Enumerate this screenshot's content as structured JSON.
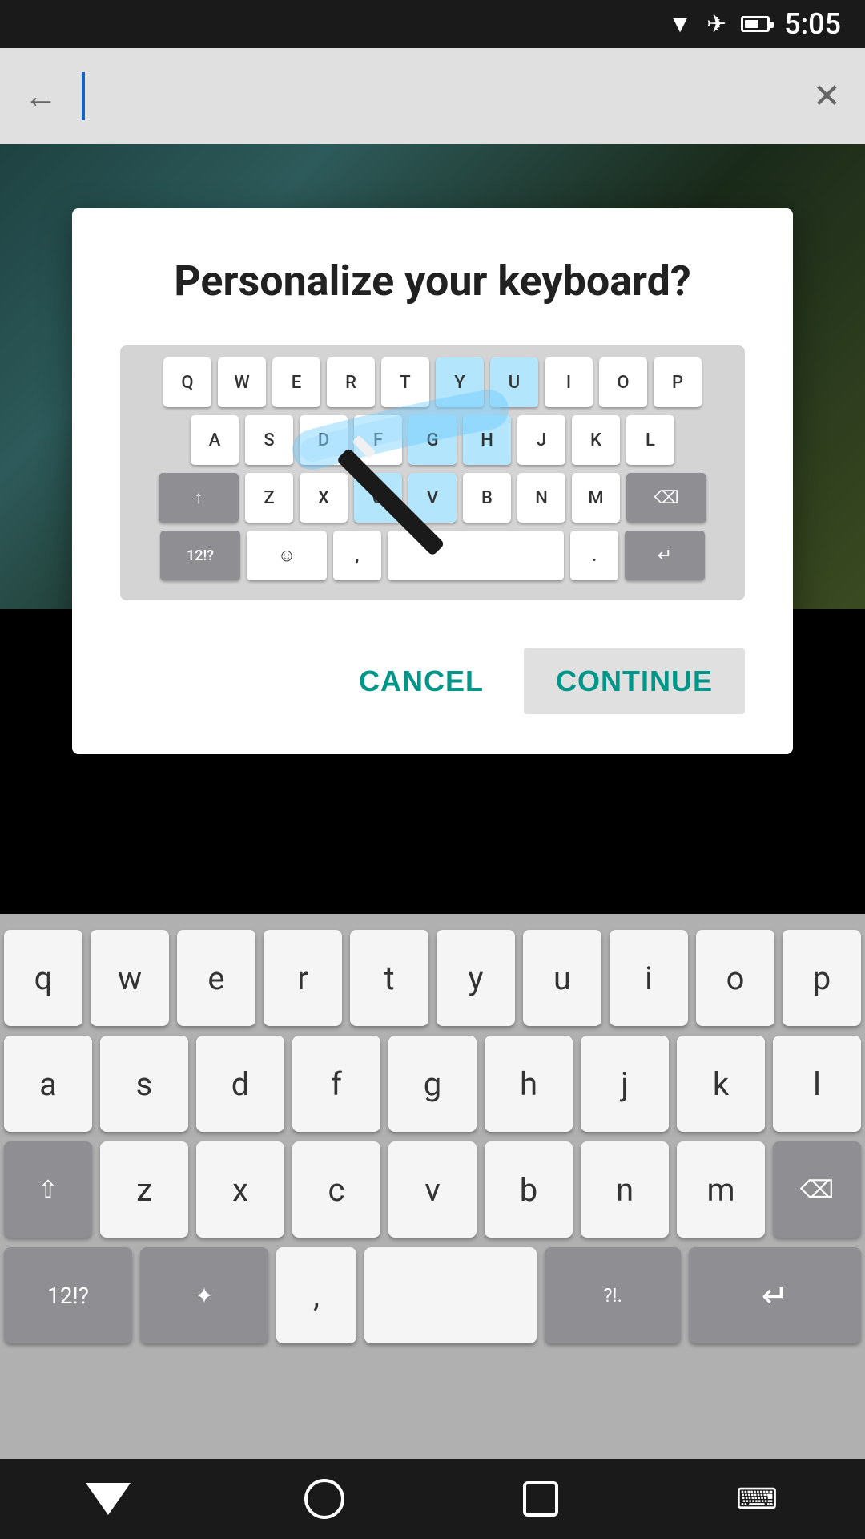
{
  "statusBar": {
    "time": "5:05"
  },
  "searchBar": {
    "backLabel": "←",
    "clearLabel": "✕"
  },
  "dialog": {
    "title": "Personalize your keyboard?",
    "miniKeyboard": {
      "rows": [
        [
          "Q",
          "W",
          "E",
          "R",
          "T",
          "Y",
          "U",
          "I",
          "O",
          "P"
        ],
        [
          "A",
          "S",
          "D",
          "F",
          "G",
          "H",
          "J",
          "K",
          "L"
        ],
        [
          "↑",
          "Z",
          "X",
          "C",
          "V",
          "B",
          "N",
          "M",
          "⌫"
        ],
        [
          "12!?",
          "☺",
          ",",
          " ",
          ".",
          "↵"
        ]
      ]
    },
    "cancelLabel": "CANCEL",
    "continueLabel": "CONTINUE"
  },
  "keyboard": {
    "rows": [
      [
        "q",
        "w",
        "e",
        "r",
        "t",
        "y",
        "u",
        "i",
        "o",
        "p"
      ],
      [
        "a",
        "s",
        "d",
        "f",
        "g",
        "h",
        "j",
        "k",
        "l"
      ],
      [
        "⇧",
        "z",
        "x",
        "c",
        "v",
        "b",
        "n",
        "m",
        "⌫"
      ],
      [
        "12!?",
        "✦",
        ",",
        "",
        "?!.",
        "↵"
      ]
    ]
  },
  "navBar": {
    "backLabel": "▽",
    "homeLabel": "○",
    "recentsLabel": "□",
    "keyboardLabel": "⌨"
  }
}
